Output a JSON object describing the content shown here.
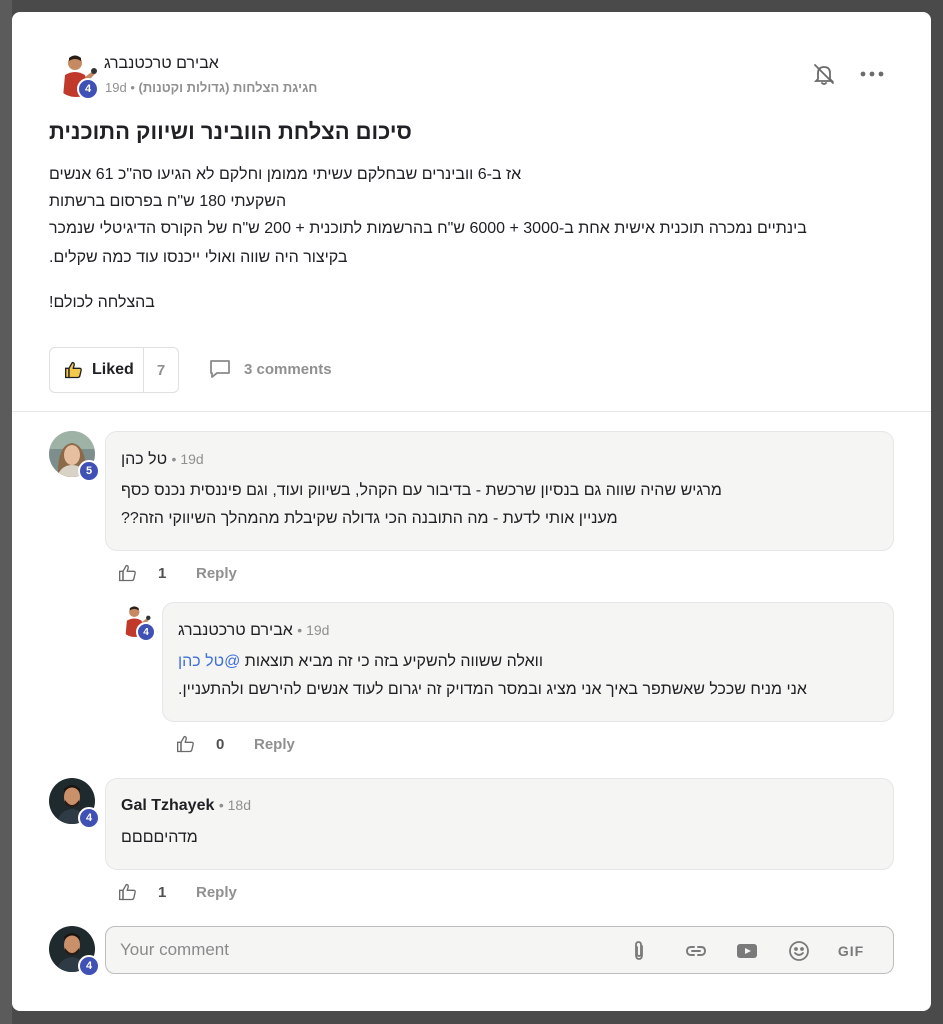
{
  "post": {
    "author": "אבירם טרכטנברג",
    "level": "4",
    "time": "19d",
    "category": "חגיגת הצלחות (גדולות וקטנות)",
    "title": "סיכום הצלחת הוובינר ושיווק התוכנית",
    "body": [
      "אז ב-6 וובינרים שבחלקם עשיתי ממומן וחלקם לא הגיעו סה\"כ 61 אנשים",
      "השקעתי 180 ש\"ח בפרסום ברשתות",
      "בינתיים נמכרה תוכנית אישית אחת ב-3000 + 6000 ש\"ח בהרשמות לתוכנית + 200 ש\"ח של הקורס הדיגיטלי שנמכר",
      "בקיצור היה שווה ואולי ייכנסו עוד כמה שקלים.",
      "בהצלחה לכולם!"
    ],
    "liked_label": "Liked",
    "like_count": "7",
    "comments_label": "3 comments"
  },
  "comments": [
    {
      "name": "טל כהן",
      "time": "19d",
      "level": "5",
      "lines": [
        "מרגיש שהיה שווה גם בנסיון שרכשת - בדיבור עם הקהל, בשיווק ועוד, וגם פיננסית נכנס כסף",
        "מעניין אותי לדעת - מה התובנה הכי גדולה שקיבלת מהמהלך השיווקי הזה??"
      ],
      "likes": "1",
      "reply_label": "Reply"
    },
    {
      "name": "אבירם טרכטנברג",
      "time": "19d",
      "level": "4",
      "mention": "@טל כהן",
      "line1": "וואלה ששווה להשקיע בזה כי זה מביא תוצאות",
      "line2": "אני מניח שככל שאשתפר באיך אני מציג ובמסר המדויק זה יגרום לעוד אנשים להירשם ולהתעניין.",
      "likes": "0",
      "reply_label": "Reply"
    },
    {
      "name": "Gal Tzhayek",
      "time": "18d",
      "level": "4",
      "lines": [
        "מדהיםםםם"
      ],
      "likes": "1",
      "reply_label": "Reply"
    }
  ],
  "composer": {
    "placeholder": "Your comment",
    "level": "4",
    "gif_label": "GIF"
  },
  "colors": {
    "badge": "#3f51b5",
    "mention": "#3f6fd9",
    "bubble": "#f5f5f4"
  }
}
